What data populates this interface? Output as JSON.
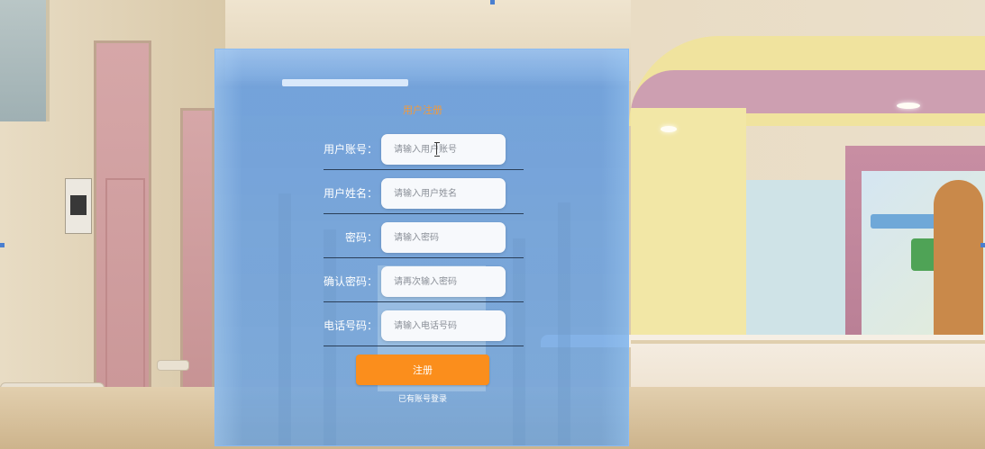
{
  "form": {
    "title": "用户注册",
    "fields": [
      {
        "label": "用户账号：",
        "placeholder": "请输入用户账号"
      },
      {
        "label": "用户姓名：",
        "placeholder": "请输入用户姓名"
      },
      {
        "label": "密码：",
        "placeholder": "请输入密码"
      },
      {
        "label": "确认密码：",
        "placeholder": "请再次输入密码"
      },
      {
        "label": "电话号码：",
        "placeholder": "请输入电话号码"
      }
    ],
    "submit_label": "注册",
    "login_link": "已有账号登录"
  },
  "colors": {
    "panel": "#5b9be6",
    "title": "#f29a3b",
    "button": "#fb8e1c"
  }
}
